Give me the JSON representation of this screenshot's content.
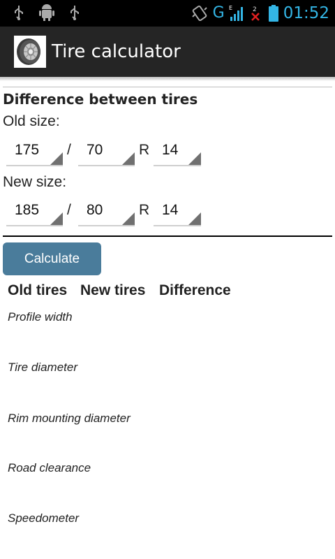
{
  "status_bar": {
    "left_icons": [
      "usb-icon",
      "android-debug-icon",
      "usb-icon"
    ],
    "network_type": "G",
    "network_sub": "E",
    "sim_badge": "2",
    "time": "01:52",
    "accent": "#33b5e5"
  },
  "action_bar": {
    "title": "Tire calculator",
    "icon": "tire-icon"
  },
  "form": {
    "heading": "Difference between tires",
    "old_size_label": "Old size:",
    "new_size_label": "New size:",
    "separator_slash": "/",
    "separator_r": "R",
    "old": {
      "width": "175",
      "profile": "70",
      "rim": "14"
    },
    "new": {
      "width": "185",
      "profile": "80",
      "rim": "14"
    }
  },
  "calculate_label": "Calculate",
  "results": {
    "columns": [
      "Old tires",
      "New tires",
      "Difference"
    ],
    "rows": [
      "Profile width",
      "Tire diameter",
      "Rim mounting diameter",
      "Road clearance",
      "Speedometer"
    ]
  },
  "colors": {
    "button": "#4a7c9b",
    "action_bar": "#252525"
  }
}
